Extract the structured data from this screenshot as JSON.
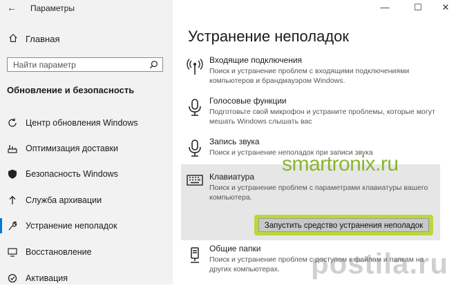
{
  "window": {
    "title": "Параметры",
    "back_glyph": "←",
    "minimize_glyph": "—",
    "maximize_glyph": "☐",
    "close_glyph": "✕"
  },
  "sidebar": {
    "home_label": "Главная",
    "search_placeholder": "Найти параметр",
    "section_title": "Обновление и безопасность",
    "items": [
      {
        "label": "Центр обновления Windows",
        "icon": "refresh-icon"
      },
      {
        "label": "Оптимизация доставки",
        "icon": "delivery-icon"
      },
      {
        "label": "Безопасность Windows",
        "icon": "shield-icon"
      },
      {
        "label": "Служба архивации",
        "icon": "backup-icon"
      },
      {
        "label": "Устранение неполадок",
        "icon": "wrench-icon",
        "active": true
      },
      {
        "label": "Восстановление",
        "icon": "recovery-icon"
      },
      {
        "label": "Активация",
        "icon": "activation-icon"
      }
    ]
  },
  "main": {
    "title": "Устранение неполадок",
    "items": [
      {
        "title": "Входящие подключения",
        "desc": "Поиск и устранение проблем с входящими подключениями компьютеров и брандмауэром Windows.",
        "icon": "antenna-icon"
      },
      {
        "title": "Голосовые функции",
        "desc": "Подготовьте свой микрофон и устраните проблемы, которые могут мешать Windows слышать вас",
        "icon": "microphone-icon"
      },
      {
        "title": "Запись звука",
        "desc": "Поиск и устранение неполадок при записи звука",
        "icon": "microphone-icon"
      },
      {
        "title": "Клавиатура",
        "desc": "Поиск и устранение проблем с параметрами клавиатуры вашего компьютера.",
        "icon": "keyboard-icon",
        "selected": true
      },
      {
        "title": "Общие папки",
        "desc": "Поиск и устранение проблем с доступом к файлам и папкам на других компьютерах.",
        "icon": "shared-folder-icon"
      }
    ],
    "run_button_label": "Запустить средство устранения неполадок"
  },
  "watermarks": {
    "top": "smartronix.ru",
    "bottom": "postila.ru"
  },
  "colors": {
    "accent": "#0078d7",
    "highlight": "#b8d83b",
    "sidebar_bg": "#f2f2f2"
  }
}
